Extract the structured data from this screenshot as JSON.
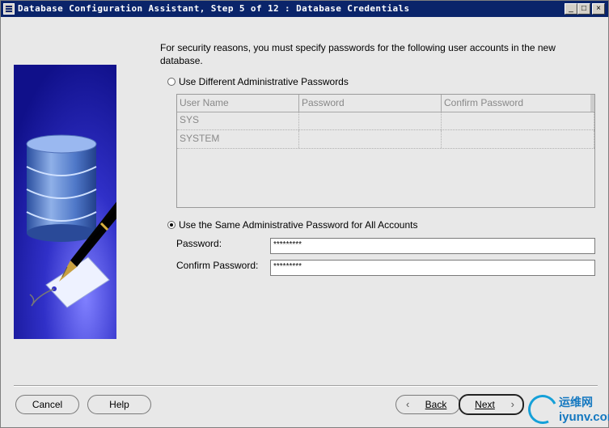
{
  "window": {
    "title": "Database Configuration Assistant, Step 5 of 12 : Database Credentials",
    "min_symbol": "_",
    "max_symbol": "□",
    "close_symbol": "×"
  },
  "content": {
    "intro": "For security reasons, you must specify passwords for the following user accounts in the new database.",
    "option_different": {
      "label": "Use Different Administrative Passwords",
      "selected": false
    },
    "table": {
      "headers": [
        "User Name",
        "Password",
        "Confirm Password"
      ],
      "rows": [
        [
          "SYS",
          "",
          ""
        ],
        [
          "SYSTEM",
          "",
          ""
        ]
      ]
    },
    "option_same": {
      "label": "Use the Same Administrative Password for All Accounts",
      "selected": true
    },
    "password": {
      "label": "Password:",
      "value": "*********"
    },
    "confirm_password": {
      "label": "Confirm Password:",
      "value": "*********"
    }
  },
  "buttons": {
    "cancel": "Cancel",
    "help": "Help",
    "back": "Back",
    "next": "Next",
    "back_icon": "chevron-left-icon",
    "next_icon": "chevron-right-icon"
  },
  "watermark": {
    "cn": "运维网",
    "en": "iyunv.com"
  },
  "colors": {
    "titlebar": "#0a246a",
    "graphic_blue": "#1a1a9a",
    "watermark_blue": "#1478c0"
  }
}
